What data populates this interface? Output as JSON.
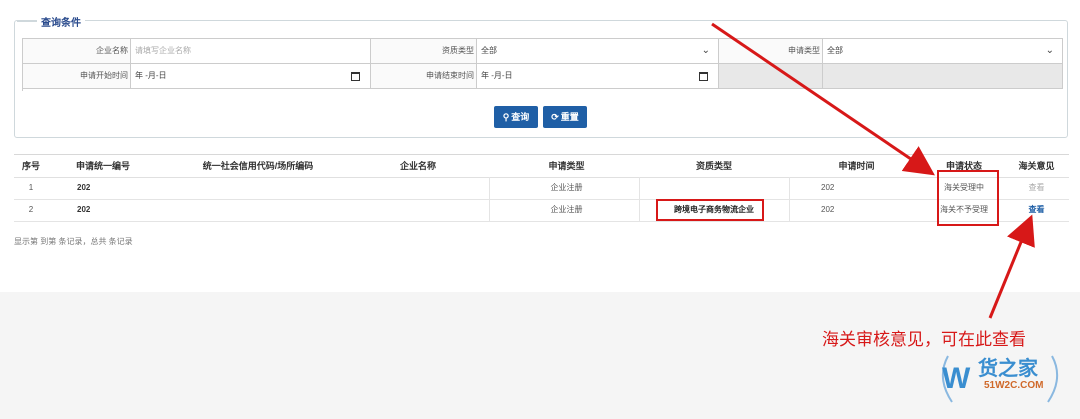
{
  "query_panel": {
    "legend": "查询条件",
    "fields": {
      "company_name_label": "企业名称",
      "company_name_placeholder": "请填写企业名称",
      "qualification_type_label": "资质类型",
      "qualification_type_value": "全部",
      "application_type_label": "申请类型",
      "application_type_value": "全部",
      "start_time_label": "申请开始时间",
      "start_time_value": "年 -月-日",
      "end_time_label": "申请结束时间",
      "end_time_value": "年 -月-日"
    },
    "buttons": {
      "search": "查询",
      "reset": "重置"
    }
  },
  "table": {
    "columns": [
      "序号",
      "申请统一编号",
      "统一社会信用代码/场所编码",
      "企业名称",
      "申请类型",
      "资质类型",
      "申请时间",
      "申请状态",
      "海关意见"
    ],
    "rows": [
      {
        "index": "1",
        "app_no": "202",
        "credit_code": "",
        "company": "",
        "app_type": "企业注册",
        "qual_type": "",
        "app_time": "202",
        "status": "海关受理中",
        "opinion": "查看"
      },
      {
        "index": "2",
        "app_no": "202",
        "credit_code": "",
        "company": "",
        "app_type": "企业注册",
        "qual_type": "跨境电子商务物流企业",
        "app_time": "202",
        "status": "海关不予受理",
        "opinion": "查看"
      }
    ]
  },
  "pager": {
    "text": "显示第 到第 条记录，总共 条记录"
  },
  "annotation": {
    "note": "海关审核意见，可在此查看",
    "color": "#d71818"
  },
  "watermark": {
    "brand": "货之家",
    "site": "51W2C.COM"
  },
  "colors": {
    "primary_button": "#1f5fa6",
    "legend_text": "#2a4b8d"
  }
}
